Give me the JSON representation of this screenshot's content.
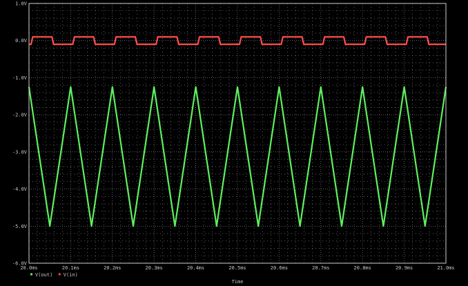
{
  "chart_data": {
    "type": "line",
    "xlabel": "Time",
    "ylabel": "",
    "xlim": [
      20.0,
      21.0
    ],
    "ylim": [
      -6.0,
      1.0
    ],
    "x_unit": "ms",
    "x_ticks": [
      "20.0ms",
      "20.1ms",
      "20.2ms",
      "20.3ms",
      "20.4ms",
      "20.5ms",
      "20.6ms",
      "20.7ms",
      "20.8ms",
      "20.9ms",
      "21.0ms"
    ],
    "y_ticks": [
      "1.0V",
      "0.0V",
      "-1.0V",
      "-2.0V",
      "-3.0V",
      "-4.0V",
      "-5.0V",
      "-6.0V"
    ],
    "grid": true,
    "legend_position": "bottom-left",
    "background": "#000000",
    "grid_color": "#9a9a9a",
    "series": [
      {
        "name": "V(out)",
        "color": "#5ef05e",
        "marker": "square",
        "shape": "triangle",
        "period_ms": 0.1,
        "max": -1.25,
        "min": -5.0,
        "peak_times_ms": [
          20.0,
          20.1,
          20.2,
          20.3,
          20.4,
          20.5,
          20.6,
          20.7,
          20.8,
          20.9,
          21.0
        ],
        "trough_times_ms": [
          20.05,
          20.15,
          20.25,
          20.35,
          20.45,
          20.55,
          20.65,
          20.75,
          20.85,
          20.95
        ]
      },
      {
        "name": "V(in)",
        "color": "#ff4d4d",
        "marker": "diamond",
        "shape": "square",
        "period_ms": 0.1,
        "high": 0.1,
        "low": -0.1,
        "high_start_ms": [
          20.005,
          20.105,
          20.205,
          20.305,
          20.405,
          20.505,
          20.605,
          20.705,
          20.805,
          20.905
        ],
        "low_start_ms": [
          20.055,
          20.155,
          20.255,
          20.355,
          20.455,
          20.555,
          20.655,
          20.755,
          20.855,
          20.955
        ]
      }
    ]
  }
}
